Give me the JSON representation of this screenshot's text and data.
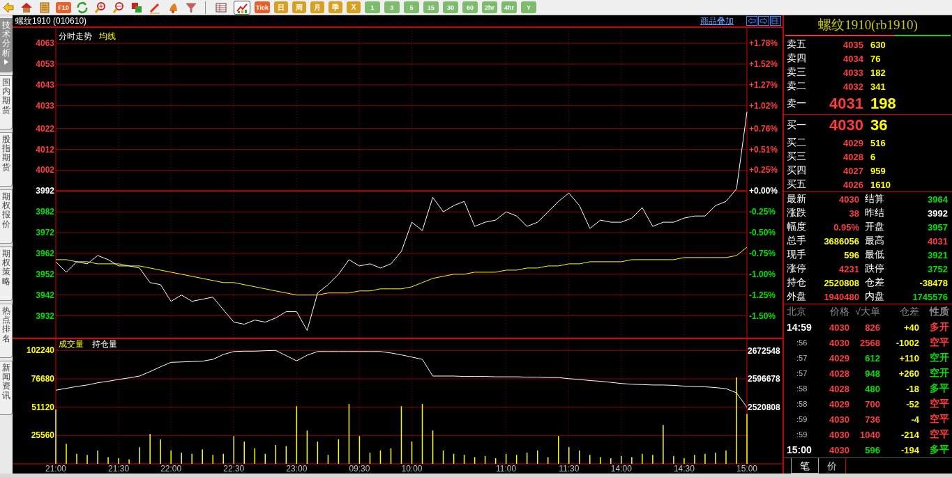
{
  "toolbar": {
    "f10_label": "F10",
    "views": [
      {
        "selected": false
      },
      {
        "selected": true
      }
    ],
    "period_buttons": [
      {
        "label": "Tick",
        "kind": "tick"
      },
      {
        "label": "日",
        "kind": "period"
      },
      {
        "label": "周",
        "kind": "period"
      },
      {
        "label": "月",
        "kind": "period"
      },
      {
        "label": "季",
        "kind": "period"
      },
      {
        "label": "X",
        "kind": "period"
      },
      {
        "label": "1",
        "kind": "minute"
      },
      {
        "label": "3",
        "kind": "minute"
      },
      {
        "label": "5",
        "kind": "minute"
      },
      {
        "label": "15",
        "kind": "minute"
      },
      {
        "label": "30",
        "kind": "minute"
      },
      {
        "label": "60",
        "kind": "minute"
      },
      {
        "label": "2hr",
        "kind": "minute"
      },
      {
        "label": "4hr",
        "kind": "minute"
      },
      {
        "label": "Y",
        "kind": "minute"
      }
    ]
  },
  "side_tabs": [
    {
      "label": "技术分析",
      "selected": true
    },
    {
      "label": "国内期货",
      "selected": false
    },
    {
      "label": "股指期货",
      "selected": false
    },
    {
      "label": "期权报价",
      "selected": false
    },
    {
      "label": "期权策略",
      "selected": false
    },
    {
      "label": "热点排名",
      "selected": false
    },
    {
      "label": "新闻资讯",
      "selected": false
    }
  ],
  "chart_header": {
    "title": "螺纹1910 (010610)",
    "overlay_link": "商品叠加"
  },
  "price_panel": {
    "percent_labels": [
      {
        "text": "+1.78%",
        "color": "#ff3b3b"
      },
      {
        "text": "+1.52%",
        "color": "#ff3b3b"
      },
      {
        "text": "+1.27%",
        "color": "#ff3b3b"
      },
      {
        "text": "+1.02%",
        "color": "#ff3b3b"
      },
      {
        "text": "+0.76%",
        "color": "#ff3b3b"
      },
      {
        "text": "+0.51%",
        "color": "#ff3b3b"
      },
      {
        "text": "+0.25%",
        "color": "#ff3b3b"
      },
      {
        "text": "+0.00%",
        "color": "#ffffff"
      },
      {
        "text": "-0.25%",
        "color": "#00e000"
      },
      {
        "text": "-0.50%",
        "color": "#00e000"
      },
      {
        "text": "-0.75%",
        "color": "#00e000"
      },
      {
        "text": "-1.00%",
        "color": "#00e000"
      },
      {
        "text": "-1.25%",
        "color": "#00e000"
      },
      {
        "text": "-1.50%",
        "color": "#00e000"
      }
    ],
    "chart_data": {
      "type": "line",
      "grid": true,
      "ylim": [
        3921.5,
        4070.4
      ],
      "yticks": [
        4063,
        4053,
        4043,
        4033,
        4022,
        4012,
        4002,
        3992,
        3982,
        3972,
        3962,
        3952,
        3942,
        3932
      ],
      "ref_lines": [
        {
          "axis": "y",
          "value": 3992
        }
      ],
      "series": [
        {
          "name": "分时走势",
          "color": "#ffffff",
          "values": [
            3958,
            3953,
            3958,
            3957,
            3961,
            3959,
            3956,
            3956,
            3955,
            3948,
            3947,
            3939,
            3942,
            3939,
            3940,
            3941,
            3935,
            3929,
            3928,
            3930,
            3929,
            3931,
            3934,
            3934,
            3925,
            3943,
            3947,
            3952,
            3959,
            3956,
            3957,
            3955,
            3957,
            3963,
            3977,
            3973,
            3989,
            3982,
            3985,
            3987,
            3975,
            3977,
            3978,
            3982,
            3980,
            3975,
            3977,
            3982,
            3987,
            3991,
            3985,
            3974,
            3978,
            3977,
            3977,
            3979,
            3984,
            3975,
            3977,
            3977,
            3979,
            3980,
            3980,
            3985,
            3987,
            3993,
            4030
          ]
        },
        {
          "name": "均线",
          "color": "#ffff00",
          "values": [
            3959,
            3959,
            3958,
            3958,
            3957,
            3957,
            3957,
            3956,
            3956,
            3955,
            3954,
            3953,
            3952,
            3951,
            3950,
            3949,
            3948,
            3948,
            3947,
            3946,
            3945,
            3944,
            3943,
            3942,
            3942,
            3942,
            3943,
            3943,
            3943,
            3944,
            3944,
            3945,
            3945,
            3945,
            3946,
            3948,
            3950,
            3951,
            3952,
            3952,
            3953,
            3953,
            3953,
            3954,
            3954,
            3955,
            3955,
            3956,
            3956,
            3957,
            3957,
            3958,
            3958,
            3958,
            3958,
            3959,
            3959,
            3959,
            3959,
            3959,
            3960,
            3960,
            3960,
            3960,
            3960,
            3961,
            3965
          ]
        }
      ]
    }
  },
  "volume_panel": {
    "chart_data": {
      "type": "bar",
      "grid": true,
      "ylim": [
        0,
        113760
      ],
      "categories": [
        "21:00",
        null,
        null,
        null,
        null,
        null,
        "21:30",
        null,
        null,
        null,
        null,
        "22:00",
        null,
        null,
        null,
        null,
        null,
        "22:30",
        null,
        null,
        null,
        null,
        null,
        "23:00",
        null,
        null,
        null,
        null,
        null,
        "09:30",
        null,
        null,
        null,
        null,
        "10:00",
        null,
        null,
        null,
        null,
        null,
        null,
        null,
        null,
        "11:00",
        null,
        null,
        null,
        null,
        null,
        "11:30",
        null,
        null,
        null,
        null,
        "14:00",
        null,
        null,
        null,
        null,
        null,
        "14:30",
        null,
        null,
        null,
        null,
        null,
        "15:00"
      ],
      "yticks": [
        102240,
        76680,
        51120,
        25560
      ],
      "series": [
        {
          "name": "成交量",
          "color": "#ffff00",
          "values": [
            49000,
            18000,
            9000,
            8000,
            12000,
            6000,
            5000,
            4000,
            15000,
            27000,
            22000,
            12000,
            10000,
            9000,
            13000,
            8000,
            9000,
            25000,
            20000,
            14000,
            9000,
            17000,
            16000,
            52000,
            30000,
            20000,
            8000,
            22000,
            54000,
            25000,
            10000,
            12000,
            14000,
            52000,
            20000,
            54000,
            30000,
            12000,
            9000,
            8000,
            6000,
            7000,
            5000,
            9000,
            8000,
            10000,
            12000,
            6000,
            25000,
            15000,
            12000,
            8000,
            6000,
            5000,
            7000,
            6000,
            9000,
            8000,
            35000,
            7000,
            5000,
            8000,
            9000,
            10000,
            12000,
            78000,
            45000
          ]
        }
      ]
    },
    "open_interest": {
      "chart_data": {
        "type": "line",
        "ylim": [
          2369100,
          2708100
        ],
        "yticks": [
          2672548,
          2596678,
          2520808
        ],
        "series": [
          {
            "name": "持仓量",
            "color": "#ffffff",
            "values": [
              2567000,
              2572000,
              2577000,
              2581000,
              2587000,
              2591000,
              2596000,
              2600000,
              2605000,
              2617000,
              2630000,
              2642000,
              2643000,
              2644000,
              2645000,
              2650000,
              2663000,
              2671000,
              2672000,
              2672000,
              2673000,
              2674000,
              2660000,
              2646000,
              2661000,
              2671000,
              2671000,
              2671000,
              2671000,
              2671000,
              2671000,
              2671000,
              2667000,
              2662000,
              2656000,
              2650000,
              2605000,
              2605000,
              2605000,
              2604000,
              2604000,
              2604000,
              2603000,
              2603000,
              2603000,
              2602000,
              2602000,
              2601000,
              2601000,
              2598000,
              2596000,
              2593000,
              2591000,
              2588000,
              2585000,
              2583000,
              2582000,
              2581000,
              2581000,
              2580000,
              2578000,
              2577000,
              2576000,
              2574000,
              2571000,
              2560000,
              2521000
            ]
          }
        ]
      }
    }
  },
  "quote_panel": {
    "title": "螺纹1910(rb1910)",
    "ratio_bar": {
      "level": 0.66
    },
    "asks": [
      {
        "label": "卖五",
        "price": "4035",
        "volume": "630",
        "best": false
      },
      {
        "label": "卖四",
        "price": "4034",
        "volume": "76",
        "best": false
      },
      {
        "label": "卖三",
        "price": "4033",
        "volume": "182",
        "best": false
      },
      {
        "label": "卖二",
        "price": "4032",
        "volume": "341",
        "best": false
      },
      {
        "label": "卖一",
        "price": "4031",
        "volume": "198",
        "best": true
      }
    ],
    "bids": [
      {
        "label": "买一",
        "price": "4030",
        "volume": "36",
        "best": true
      },
      {
        "label": "买二",
        "price": "4029",
        "volume": "516",
        "best": false
      },
      {
        "label": "买三",
        "price": "4028",
        "volume": "6",
        "best": false
      },
      {
        "label": "买四",
        "price": "4027",
        "volume": "959",
        "best": false
      },
      {
        "label": "买五",
        "price": "4026",
        "volume": "1610",
        "best": false
      }
    ],
    "stats": [
      {
        "label": "最新",
        "value": "4030",
        "color": "#ff3b3b"
      },
      {
        "label": "结算",
        "value": "3964",
        "color": "#00e000"
      },
      {
        "label": "涨跌",
        "value": "38",
        "color": "#ff3b3b"
      },
      {
        "label": "昨结",
        "value": "3992",
        "color": "#ffffff"
      },
      {
        "label": "幅度",
        "value": "0.95%",
        "color": "#ff3b3b"
      },
      {
        "label": "开盘",
        "value": "3957",
        "color": "#00e000"
      },
      {
        "label": "总手",
        "value": "3686056",
        "color": "#ffff00"
      },
      {
        "label": "最高",
        "value": "4031",
        "color": "#ff3b3b"
      },
      {
        "label": "现手",
        "value": "596",
        "color": "#ffff00"
      },
      {
        "label": "最低",
        "value": "3921",
        "color": "#00e000"
      },
      {
        "label": "涨停",
        "value": "4231",
        "color": "#ff3b3b"
      },
      {
        "label": "跌停",
        "value": "3752",
        "color": "#00e000"
      },
      {
        "label": "持仓",
        "value": "2520808",
        "color": "#ffff00"
      },
      {
        "label": "仓差",
        "value": "-38478",
        "color": "#ffff00"
      },
      {
        "label": "外盘",
        "value": "1940480",
        "color": "#ff3b3b"
      },
      {
        "label": "内盘",
        "value": "1745576",
        "color": "#00e000"
      }
    ],
    "trade_columns": [
      "北京",
      "价格",
      "√大单",
      "仓差",
      "性质"
    ],
    "trades": [
      {
        "time": {
          "text": "14:59",
          "kind": "full"
        },
        "price": {
          "text": "4030",
          "color": "#ff3b3b"
        },
        "volume": {
          "text": "826",
          "color": "#ff3b3b"
        },
        "change": "+40",
        "nature": {
          "text": "多开",
          "color": "#ff3b3b"
        }
      },
      {
        "time": {
          "text": ":56",
          "kind": "sub"
        },
        "price": {
          "text": "4030",
          "color": "#ff3b3b"
        },
        "volume": {
          "text": "2568",
          "color": "#ff3b3b"
        },
        "change": "-1002",
        "nature": {
          "text": "空平",
          "color": "#ff3b3b"
        }
      },
      {
        "time": {
          "text": ":57",
          "kind": "sub"
        },
        "price": {
          "text": "4029",
          "color": "#ff3b3b"
        },
        "volume": {
          "text": "612",
          "color": "#00e000"
        },
        "change": "+110",
        "nature": {
          "text": "空开",
          "color": "#00e000"
        }
      },
      {
        "time": {
          "text": ":57",
          "kind": "sub"
        },
        "price": {
          "text": "4028",
          "color": "#ff3b3b"
        },
        "volume": {
          "text": "948",
          "color": "#00e000"
        },
        "change": "+260",
        "nature": {
          "text": "空开",
          "color": "#00e000"
        }
      },
      {
        "time": {
          "text": ":58",
          "kind": "sub"
        },
        "price": {
          "text": "4028",
          "color": "#ff3b3b"
        },
        "volume": {
          "text": "480",
          "color": "#00e000"
        },
        "change": "-18",
        "nature": {
          "text": "多平",
          "color": "#00e000"
        }
      },
      {
        "time": {
          "text": ":58",
          "kind": "sub"
        },
        "price": {
          "text": "4029",
          "color": "#ff3b3b"
        },
        "volume": {
          "text": "700",
          "color": "#ff3b3b"
        },
        "change": "-52",
        "nature": {
          "text": "空平",
          "color": "#ff3b3b"
        }
      },
      {
        "time": {
          "text": ":59",
          "kind": "sub"
        },
        "price": {
          "text": "4030",
          "color": "#ff3b3b"
        },
        "volume": {
          "text": "736",
          "color": "#ff3b3b"
        },
        "change": "-4",
        "nature": {
          "text": "空平",
          "color": "#ff3b3b"
        }
      },
      {
        "time": {
          "text": ":59",
          "kind": "sub"
        },
        "price": {
          "text": "4030",
          "color": "#ff3b3b"
        },
        "volume": {
          "text": "1040",
          "color": "#ff3b3b"
        },
        "change": "-214",
        "nature": {
          "text": "空平",
          "color": "#ff3b3b"
        }
      },
      {
        "time": {
          "text": "15:00",
          "kind": "full"
        },
        "price": {
          "text": "4030",
          "color": "#ff3b3b"
        },
        "volume": {
          "text": "596",
          "color": "#00e000"
        },
        "change": "-194",
        "nature": {
          "text": "多平",
          "color": "#00e000"
        }
      }
    ],
    "bottom_tabs": [
      {
        "label": "笔",
        "selected": true
      },
      {
        "label": "价",
        "selected": false
      }
    ]
  }
}
